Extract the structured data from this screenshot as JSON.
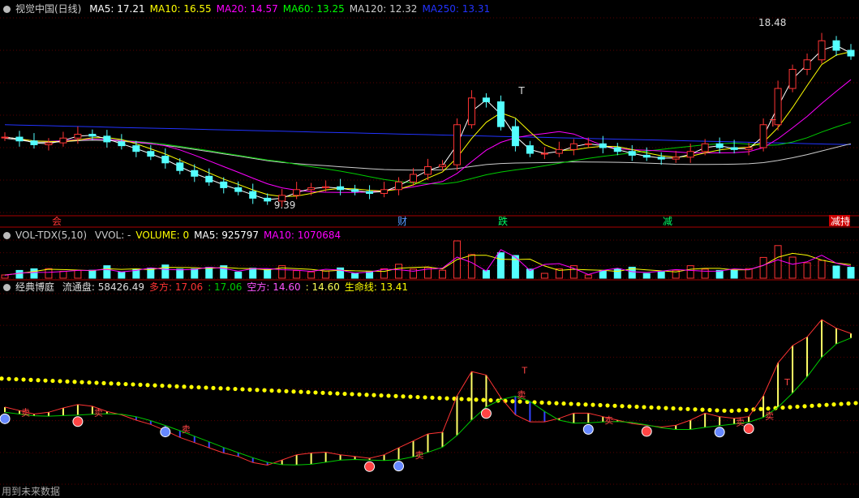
{
  "price_panel": {
    "title": "视觉中国(日线)",
    "ma": [
      {
        "label": "MA5:",
        "value": "17.21",
        "color": "#ffffff"
      },
      {
        "label": "MA10:",
        "value": "16.55",
        "color": "#ffff00"
      },
      {
        "label": "MA20:",
        "value": "14.57",
        "color": "#ff00ff"
      },
      {
        "label": "MA60:",
        "value": "13.25",
        "color": "#00ff00"
      },
      {
        "label": "MA120:",
        "value": "12.32",
        "color": "#cccccc"
      },
      {
        "label": "MA250:",
        "value": "13.31",
        "color": "#2233ff"
      }
    ],
    "high_label": "18.48",
    "low_label": "9.39",
    "markers": [
      "T",
      "T"
    ],
    "event_tags": [
      "会",
      "财",
      "跌",
      "减",
      "减持"
    ]
  },
  "volume_panel": {
    "title": "VOL-TDX(5,10)",
    "items": [
      {
        "label": "VVOL:",
        "value": "-",
        "color": "#cccccc"
      },
      {
        "label": "VOLUME:",
        "value": "0",
        "color": "#ffff00"
      },
      {
        "label": "MA5:",
        "value": "925797",
        "color": "#ffffff"
      },
      {
        "label": "MA10:",
        "value": "1070684",
        "color": "#ff00ff"
      }
    ]
  },
  "indicator_panel": {
    "title": "经典博庭",
    "items": [
      {
        "label": "流通盘:",
        "value": "58426.49",
        "color": "#dddddd"
      },
      {
        "label": "多方:",
        "value": "17.06",
        "color": "#ff3333"
      },
      {
        "label": ":",
        "value": "17.06",
        "color": "#00cc00"
      },
      {
        "label": "空方:",
        "value": "14.60",
        "color": "#ff55ff"
      },
      {
        "label": ":",
        "value": "14.60",
        "color": "#ffff55"
      },
      {
        "label": "生命线:",
        "value": "13.41",
        "color": "#ffff00"
      }
    ],
    "signal_labels": [
      "卖",
      "卖",
      "卖",
      "卖",
      "卖",
      "卖",
      "卖",
      "卖"
    ],
    "markers": [
      "T",
      "T"
    ]
  },
  "footer": "用到未来数据",
  "chart_data": {
    "type": "candlestick",
    "price_range": [
      9.39,
      18.48
    ],
    "ma_values": {
      "MA5": 17.21,
      "MA10": 16.55,
      "MA20": 14.57,
      "MA60": 13.25,
      "MA120": 12.32,
      "MA250": 13.31
    },
    "volume": {
      "VOLUME": 0,
      "MA5": 925797,
      "MA10": 1070684
    },
    "indicator": {
      "流通盘": 58426.49,
      "多方": 17.06,
      "空方": 14.6,
      "生命线": 13.41
    },
    "close_path": [
      [
        0,
        12.95
      ],
      [
        12,
        12.75
      ],
      [
        20,
        12.55
      ],
      [
        30,
        12.65
      ],
      [
        40,
        12.9
      ],
      [
        48,
        13.1
      ],
      [
        60,
        13.0
      ],
      [
        72,
        12.7
      ],
      [
        82,
        12.5
      ],
      [
        95,
        12.2
      ],
      [
        110,
        11.95
      ],
      [
        120,
        11.6
      ],
      [
        130,
        11.2
      ],
      [
        140,
        10.9
      ],
      [
        150,
        10.6
      ],
      [
        160,
        10.3
      ],
      [
        170,
        10.1
      ],
      [
        178,
        9.75
      ],
      [
        184,
        9.6
      ],
      [
        190,
        9.9
      ],
      [
        200,
        10.2
      ],
      [
        212,
        10.3
      ],
      [
        222,
        10.35
      ],
      [
        232,
        10.2
      ],
      [
        242,
        10.1
      ],
      [
        252,
        10.0
      ],
      [
        262,
        10.2
      ],
      [
        272,
        10.6
      ],
      [
        282,
        11.0
      ],
      [
        290,
        11.4
      ],
      [
        296,
        11.5
      ],
      [
        302,
        13.6
      ],
      [
        307,
        15.0
      ],
      [
        311,
        14.8
      ],
      [
        316,
        13.5
      ],
      [
        322,
        12.5
      ],
      [
        328,
        12.1
      ],
      [
        335,
        12.1
      ],
      [
        343,
        12.3
      ],
      [
        350,
        12.6
      ],
      [
        360,
        12.6
      ],
      [
        370,
        12.4
      ],
      [
        380,
        12.2
      ],
      [
        390,
        12.0
      ],
      [
        400,
        11.9
      ],
      [
        410,
        11.8
      ],
      [
        420,
        11.9
      ],
      [
        430,
        12.2
      ],
      [
        440,
        12.6
      ],
      [
        450,
        12.4
      ],
      [
        460,
        12.3
      ],
      [
        470,
        12.4
      ],
      [
        480,
        13.6
      ],
      [
        488,
        15.5
      ],
      [
        494,
        16.5
      ],
      [
        500,
        17.0
      ],
      [
        506,
        18.0
      ],
      [
        512,
        17.5
      ],
      [
        518,
        17.2
      ]
    ]
  }
}
